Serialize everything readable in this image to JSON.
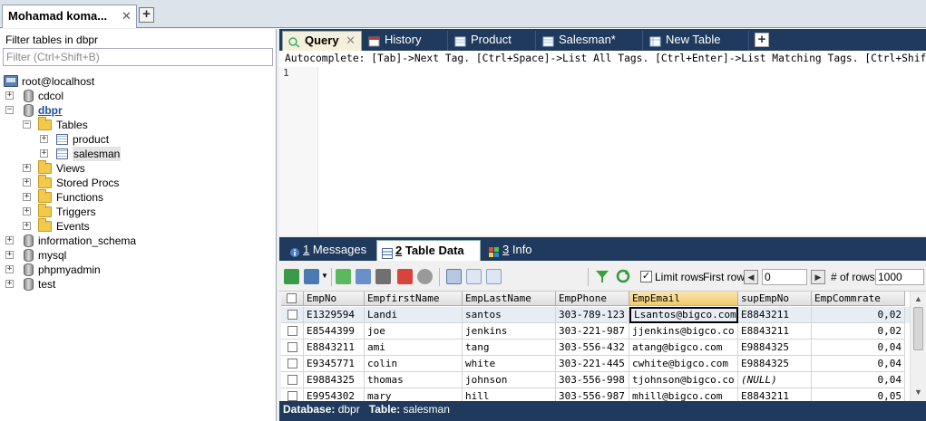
{
  "connection_tab": {
    "label": "Mohamad koma...",
    "close": "✕",
    "add": "+"
  },
  "object_browser": {
    "filter_label": "Filter tables in dbpr",
    "filter_placeholder": "Filter (Ctrl+Shift+B)",
    "server": "root@localhost",
    "databases": [
      "cdcol",
      "dbpr",
      "information_schema",
      "mysql",
      "phpmyadmin",
      "test"
    ],
    "dbpr_folders": [
      "Tables",
      "Views",
      "Stored Procs",
      "Functions",
      "Triggers",
      "Events"
    ],
    "tables": [
      "product",
      "salesman"
    ]
  },
  "query_tabs": [
    {
      "label": "Query",
      "icon": "query-icon"
    },
    {
      "label": "History",
      "icon": "history-icon"
    },
    {
      "label": "Product",
      "icon": "table-icon"
    },
    {
      "label": "Salesman*",
      "icon": "table-icon"
    },
    {
      "label": "New Table",
      "icon": "new-table-icon"
    }
  ],
  "query_tab_close": "✕",
  "query_tab_add": "+",
  "editor": {
    "autocomplete_hint": "Autocomplete: [Tab]->Next Tag. [Ctrl+Space]->List All Tags. [Ctrl+Enter]->List Matching Tags. [Ctrl+Shift+Space]->Lis...",
    "line_number": "1"
  },
  "result_tabs": [
    {
      "num": "1",
      "label": " Messages"
    },
    {
      "num": "2",
      "label": " Table Data"
    },
    {
      "num": "3",
      "label": " Info"
    }
  ],
  "toolbar": {
    "limit_rows_label": "Limit rows",
    "limit_rows_checked": "✓",
    "first_row_label": "First row",
    "first_row_value": "0",
    "rows_label": "# of rows",
    "rows_value": "1000",
    "prev": "◀",
    "next": "▶"
  },
  "grid": {
    "columns": [
      "EmpNo",
      "EmpfirstName",
      "EmpLastName",
      "EmpPhone",
      "EmpEmail",
      "supEmpNo",
      "EmpCommrate"
    ],
    "rows": [
      [
        "E1329594",
        "Landi",
        "santos",
        "303-789-123",
        "Lsantos@bigco.com",
        "E8843211",
        "0,02"
      ],
      [
        "E8544399",
        "joe",
        "jenkins",
        "303-221-987",
        "jjenkins@bigco.co",
        "E8843211",
        "0,02"
      ],
      [
        "E8843211",
        "ami",
        "tang",
        "303-556-432",
        "atang@bigco.com",
        "E9884325",
        "0,04"
      ],
      [
        "E9345771",
        "colin",
        "white",
        "303-221-445",
        "cwhite@bigco.com",
        "E9884325",
        "0,04"
      ],
      [
        "E9884325",
        "thomas",
        "johnson",
        "303-556-998",
        "tjohnson@bigco.co",
        "(NULL)",
        "0,04"
      ],
      [
        "E9954302",
        "mary",
        "hill",
        "303-556-987",
        "mhill@bigco.com",
        "E8843211",
        "0,05"
      ]
    ]
  },
  "status_bar": {
    "database_label": "Database:",
    "database_value": "dbpr",
    "table_label": "Table:",
    "table_value": "salesman"
  },
  "colors": {
    "accent_dark": "#1f3a5c",
    "active_tab": "#f5f0dc",
    "selected_header": "#f1c96a"
  }
}
